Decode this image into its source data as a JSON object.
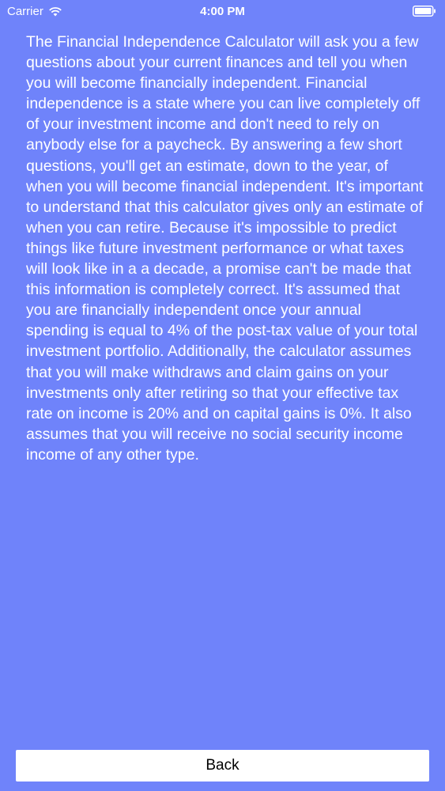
{
  "status_bar": {
    "carrier": "Carrier",
    "time": "4:00 PM",
    "wifi_icon": "wifi-icon",
    "battery_icon": "battery-full-icon"
  },
  "content": {
    "paragraph": "The Financial Independence Calculator will ask you a few questions about your current finances and tell you when you will become financially independent. Financial independence is a state where you can live completely off of your investment income and don't need to rely on anybody else for a paycheck. By answering a few short questions, you'll get an estimate, down to the year, of when you will become financial independent. It's important to understand that this calculator gives only an estimate of when you can retire. Because it's impossible to predict things like future investment performance or what taxes will look like in a a decade, a promise can't be made that this information is completely correct. It's assumed that you are financially independent once your annual spending is equal to 4% of the post-tax value of your total investment portfolio. Additionally, the calculator assumes that you will make withdraws and claim gains on your investments only after retiring so that your effective tax rate on income is 20% and on capital gains is 0%. It also assumes that you will receive no social security income income of any other type."
  },
  "footer": {
    "back_label": "Back"
  },
  "colors": {
    "background": "#6f83fa",
    "text": "#ffffff",
    "button_background": "#ffffff",
    "button_text": "#000000"
  }
}
